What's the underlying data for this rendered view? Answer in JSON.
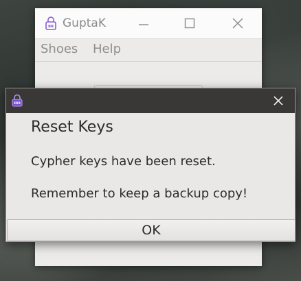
{
  "main_window": {
    "title": "GuptaK",
    "app_icon": "gupta-app-icon",
    "controls": {
      "minimize_icon": "minimize-icon",
      "maximize_icon": "maximize-icon",
      "close_icon": "close-icon"
    },
    "menu": [
      {
        "label": "Shoes"
      },
      {
        "label": "Help"
      }
    ]
  },
  "dialog": {
    "app_icon": "gupta-app-icon",
    "close_icon": "close-icon",
    "heading": "Reset Keys",
    "message_line1": "Cypher keys have been reset.",
    "message_line2": "Remember to keep a backup copy!",
    "ok_label": "OK"
  },
  "colors": {
    "dialog_titlebar": "#393836",
    "dialog_body": "#e9e8e6",
    "main_titlebar": "#fbfbfb",
    "app_icon_accent": "#8a5cd8"
  }
}
